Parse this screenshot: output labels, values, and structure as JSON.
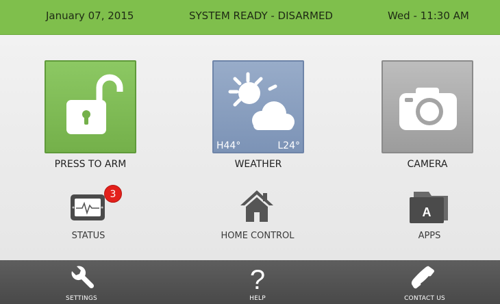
{
  "topbar": {
    "date": "January 07, 2015",
    "status": "SYSTEM READY - DISARMED",
    "clock": "Wed - 11:30 AM"
  },
  "tiles": {
    "arm": {
      "label": "PRESS TO ARM",
      "icon": "unlocked-padlock-icon",
      "color": "#7fbf4c"
    },
    "weather": {
      "label": "WEATHER",
      "icon": "partly-cloudy-icon",
      "high": "H44°",
      "low": "L24°",
      "color": "#8aa0c0"
    },
    "camera": {
      "label": "CAMERA",
      "icon": "camera-icon",
      "color": "#aaaaaa"
    }
  },
  "shortcuts": {
    "status": {
      "label": "STATUS",
      "icon": "status-monitor-icon",
      "badge": "3"
    },
    "home_control": {
      "label": "HOME CONTROL",
      "icon": "house-icon"
    },
    "apps": {
      "label": "APPS",
      "icon": "apps-folder-icon",
      "letter": "A"
    }
  },
  "bottombar": {
    "settings": {
      "label": "SETTINGS",
      "icon": "wrench-icon"
    },
    "help": {
      "label": "HELP",
      "icon": "question-mark-icon",
      "glyph": "?"
    },
    "contact": {
      "label": "CONTACT US",
      "icon": "phone-icon"
    }
  },
  "colors": {
    "accent_green": "#7fbf4c",
    "badge_red": "#e3201b",
    "bottom_bar": "#555555"
  }
}
